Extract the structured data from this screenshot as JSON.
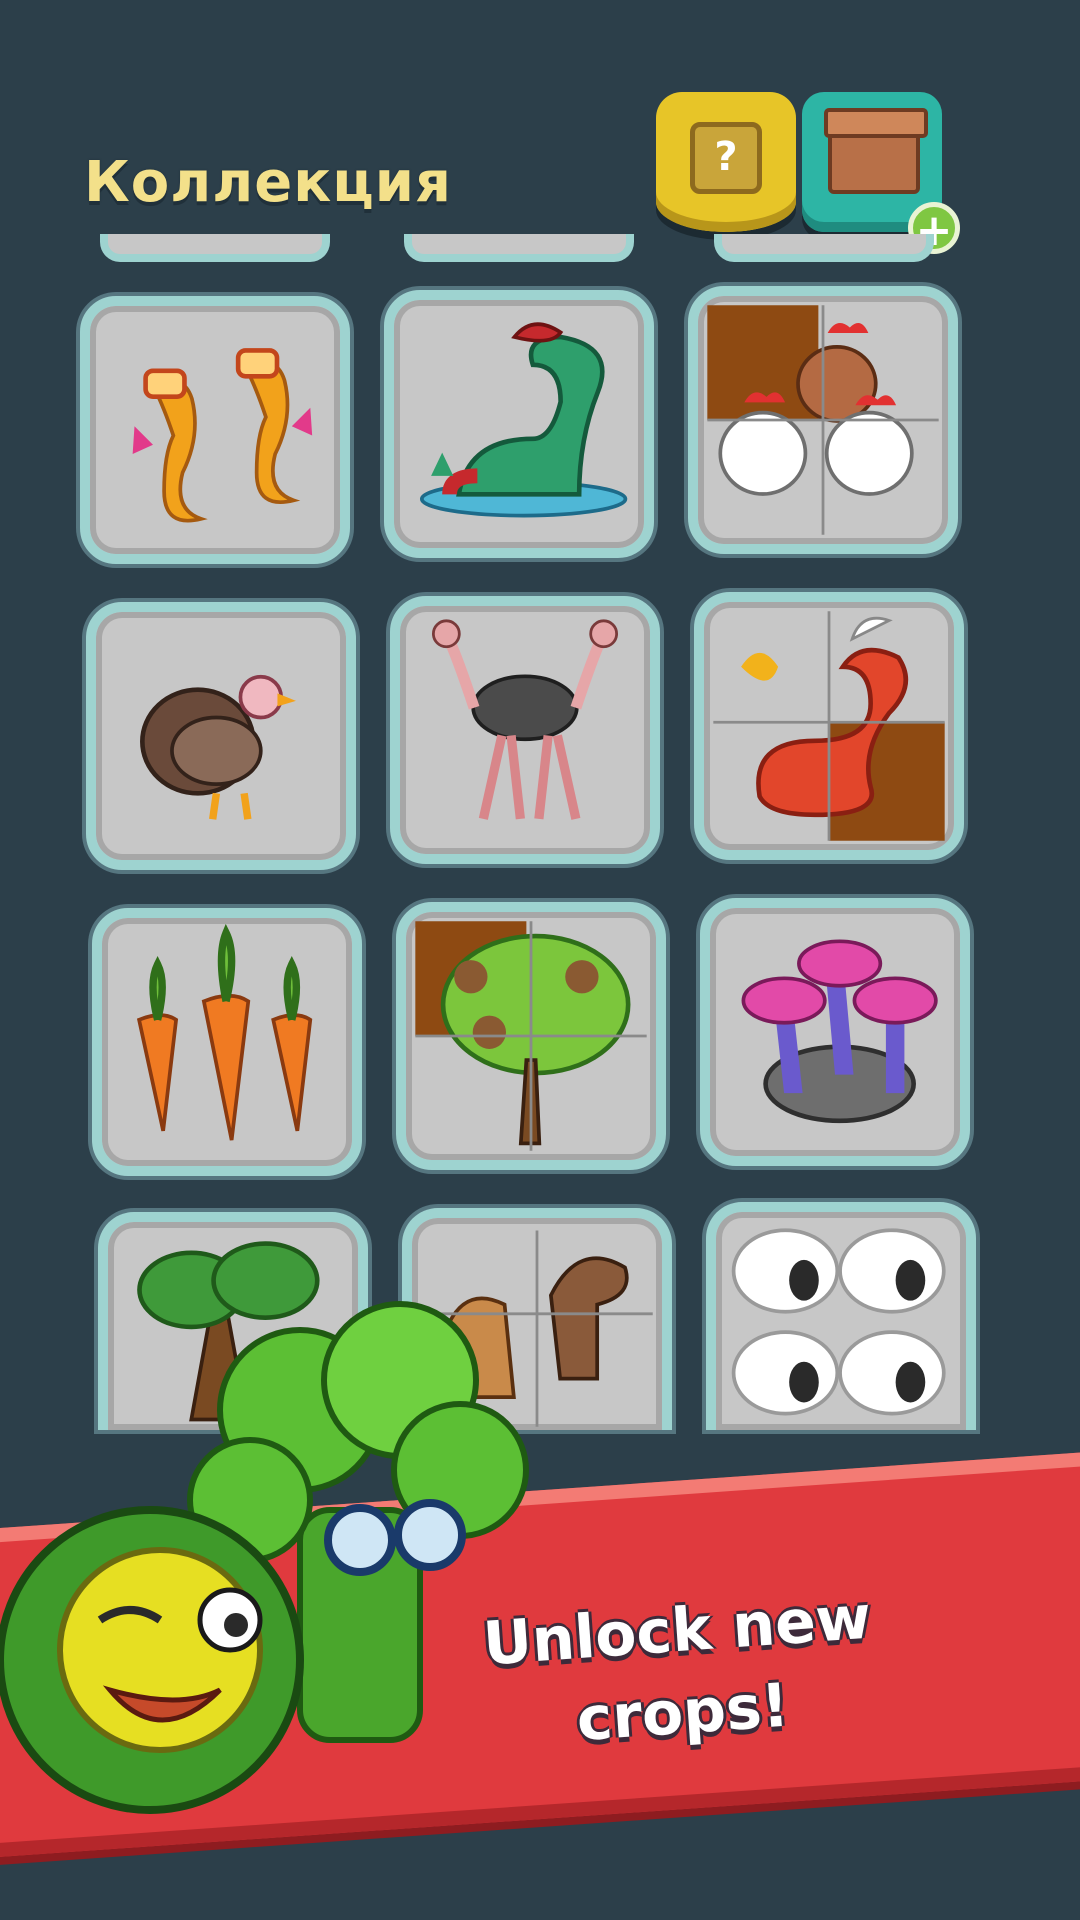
{
  "header": {
    "title": "Коллекция",
    "help_button_label": "?",
    "box_add_label": "+"
  },
  "collection": {
    "cards": [
      {
        "name": "card-seahorses",
        "icon": "seahorse-icon"
      },
      {
        "name": "card-sea-monster",
        "icon": "sea-monster-icon"
      },
      {
        "name": "card-chickens",
        "icon": "chicken-icon"
      },
      {
        "name": "card-turkey",
        "icon": "turkey-icon"
      },
      {
        "name": "card-ostriches",
        "icon": "ostrich-icon"
      },
      {
        "name": "card-dragon",
        "icon": "dragon-icon"
      },
      {
        "name": "card-carrots",
        "icon": "carrot-icon"
      },
      {
        "name": "card-tree",
        "icon": "tree-icon"
      },
      {
        "name": "card-mushrooms",
        "icon": "mushroom-icon"
      },
      {
        "name": "card-oak",
        "icon": "oak-icon"
      },
      {
        "name": "card-horses",
        "icon": "horse-icon"
      },
      {
        "name": "card-sheep",
        "icon": "sheep-icon"
      }
    ]
  },
  "promo": {
    "banner_text": "Unlock new crops!"
  },
  "colors": {
    "background": "#2c3f4a",
    "title": "#f3e08a",
    "card_border": "#9ed3d0",
    "card_fill": "#c7c7c7",
    "help_button": "#e7c528",
    "box_button": "#2db5a5",
    "banner": "#e03a3e"
  }
}
